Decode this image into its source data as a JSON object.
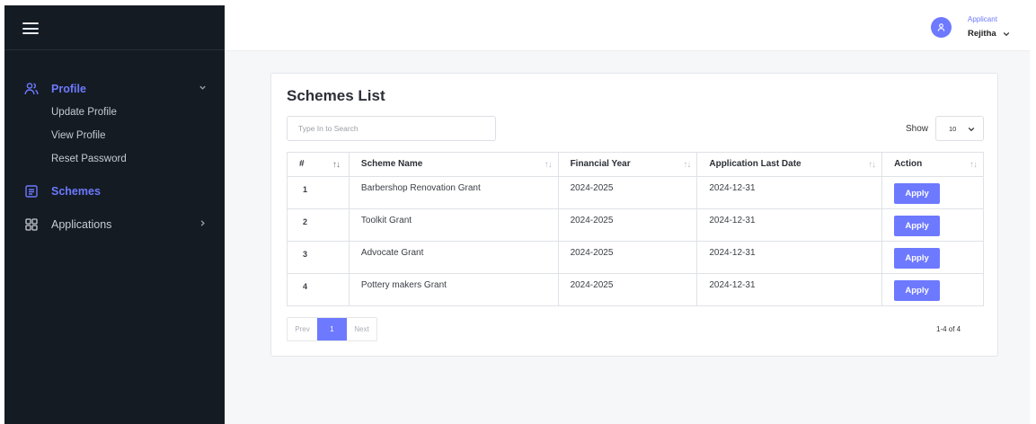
{
  "sidebar": {
    "items": [
      {
        "label": "Profile",
        "icon": "users-icon",
        "expanded": true,
        "children": [
          "Update Profile",
          "View Profile",
          "Reset Password"
        ]
      },
      {
        "label": "Schemes",
        "icon": "list-icon",
        "active": true
      },
      {
        "label": "Applications",
        "icon": "grid-icon",
        "expanded": false
      }
    ]
  },
  "header": {
    "user_role": "Applicant",
    "user_name": "Rejitha"
  },
  "schemes": {
    "title": "Schemes List",
    "search_placeholder": "Type In to Search",
    "show_label": "Show",
    "page_size": "10",
    "columns": [
      "#",
      "Scheme Name",
      "Financial Year",
      "Application Last Date",
      "Action"
    ],
    "rows": [
      {
        "num": "1",
        "name": "Barbershop Renovation Grant",
        "year": "2024-2025",
        "last_date": "2024-12-31",
        "action": "Apply"
      },
      {
        "num": "2",
        "name": "Toolkit Grant",
        "year": "2024-2025",
        "last_date": "2024-12-31",
        "action": "Apply"
      },
      {
        "num": "3",
        "name": "Advocate Grant",
        "year": "2024-2025",
        "last_date": "2024-12-31",
        "action": "Apply"
      },
      {
        "num": "4",
        "name": "Pottery makers Grant",
        "year": "2024-2025",
        "last_date": "2024-12-31",
        "action": "Apply"
      }
    ],
    "pagination": {
      "prev": "Prev",
      "current": "1",
      "next": "Next",
      "info": "1-4 of 4"
    }
  },
  "colors": {
    "accent": "#6d79ff",
    "sidebar_bg": "#141b23"
  }
}
